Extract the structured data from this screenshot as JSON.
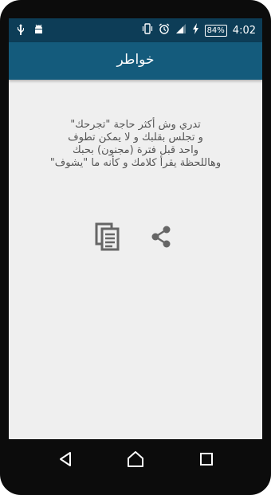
{
  "status_bar": {
    "time": "4:02",
    "battery_percent": "84%",
    "icons_left": [
      "usb-icon",
      "android-debug-icon"
    ],
    "icons_right": [
      "vibrate-icon",
      "alarm-icon",
      "signal-icon",
      "charging-icon",
      "battery-icon"
    ]
  },
  "app_bar": {
    "title": "خواطر",
    "color": "#145b7c"
  },
  "quote": {
    "lines": [
      "تدري وش أكثر حاجة \"تجرحك\"",
      "و تجلس بقلبك و لا يمكن تطوف",
      "واحد قبل فترة (مجنون) بحبك",
      "وهاللحظة يقرأ كلامك و كأنه ما \"يشوف\""
    ]
  },
  "actions": {
    "copy_icon": "copy-icon",
    "share_icon": "share-icon"
  },
  "nav_bar": {
    "buttons": [
      "back-icon",
      "home-icon",
      "recent-apps-icon"
    ]
  }
}
